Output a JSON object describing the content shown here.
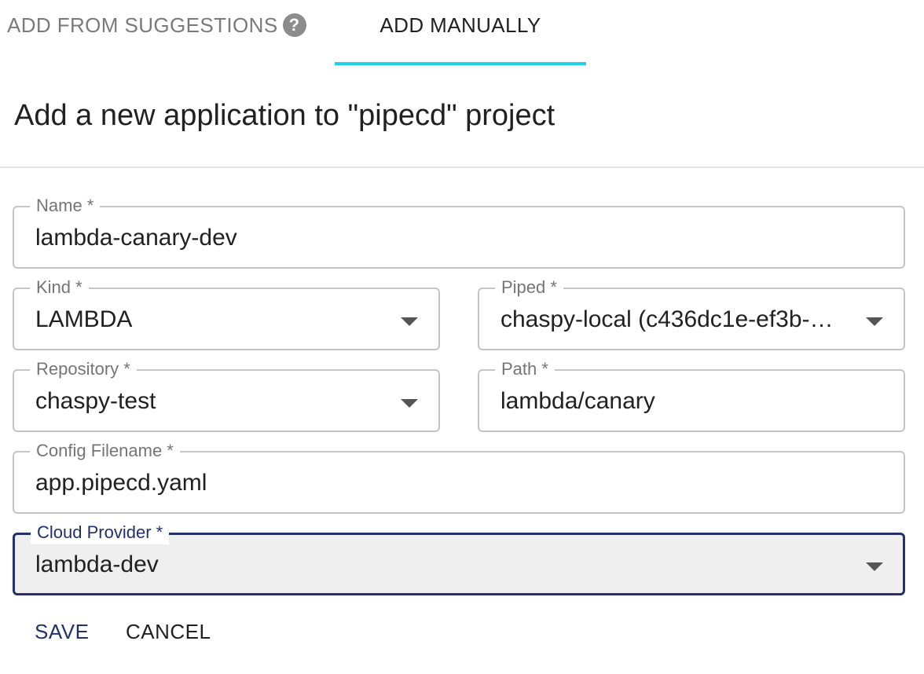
{
  "tabs": {
    "suggestions_label": "ADD FROM SUGGESTIONS",
    "suggestions_help": "?",
    "manual_label": "ADD MANUALLY"
  },
  "title": "Add a new application to \"pipecd\" project",
  "form": {
    "name": {
      "label": "Name *",
      "value": "lambda-canary-dev"
    },
    "kind": {
      "label": "Kind *",
      "value": "LAMBDA"
    },
    "piped": {
      "label": "Piped *",
      "value": "chaspy-local (c436dc1e-ef3b-…"
    },
    "repository": {
      "label": "Repository *",
      "value": "chaspy-test"
    },
    "path": {
      "label": "Path *",
      "value": "lambda/canary"
    },
    "config_filename": {
      "label": "Config Filename *",
      "value": "app.pipecd.yaml"
    },
    "cloud_provider": {
      "label": "Cloud Provider *",
      "value": "lambda-dev"
    }
  },
  "actions": {
    "save": "SAVE",
    "cancel": "CANCEL"
  },
  "colors": {
    "tab_indicator": "#1fd2e8",
    "primary": "#24306b"
  }
}
